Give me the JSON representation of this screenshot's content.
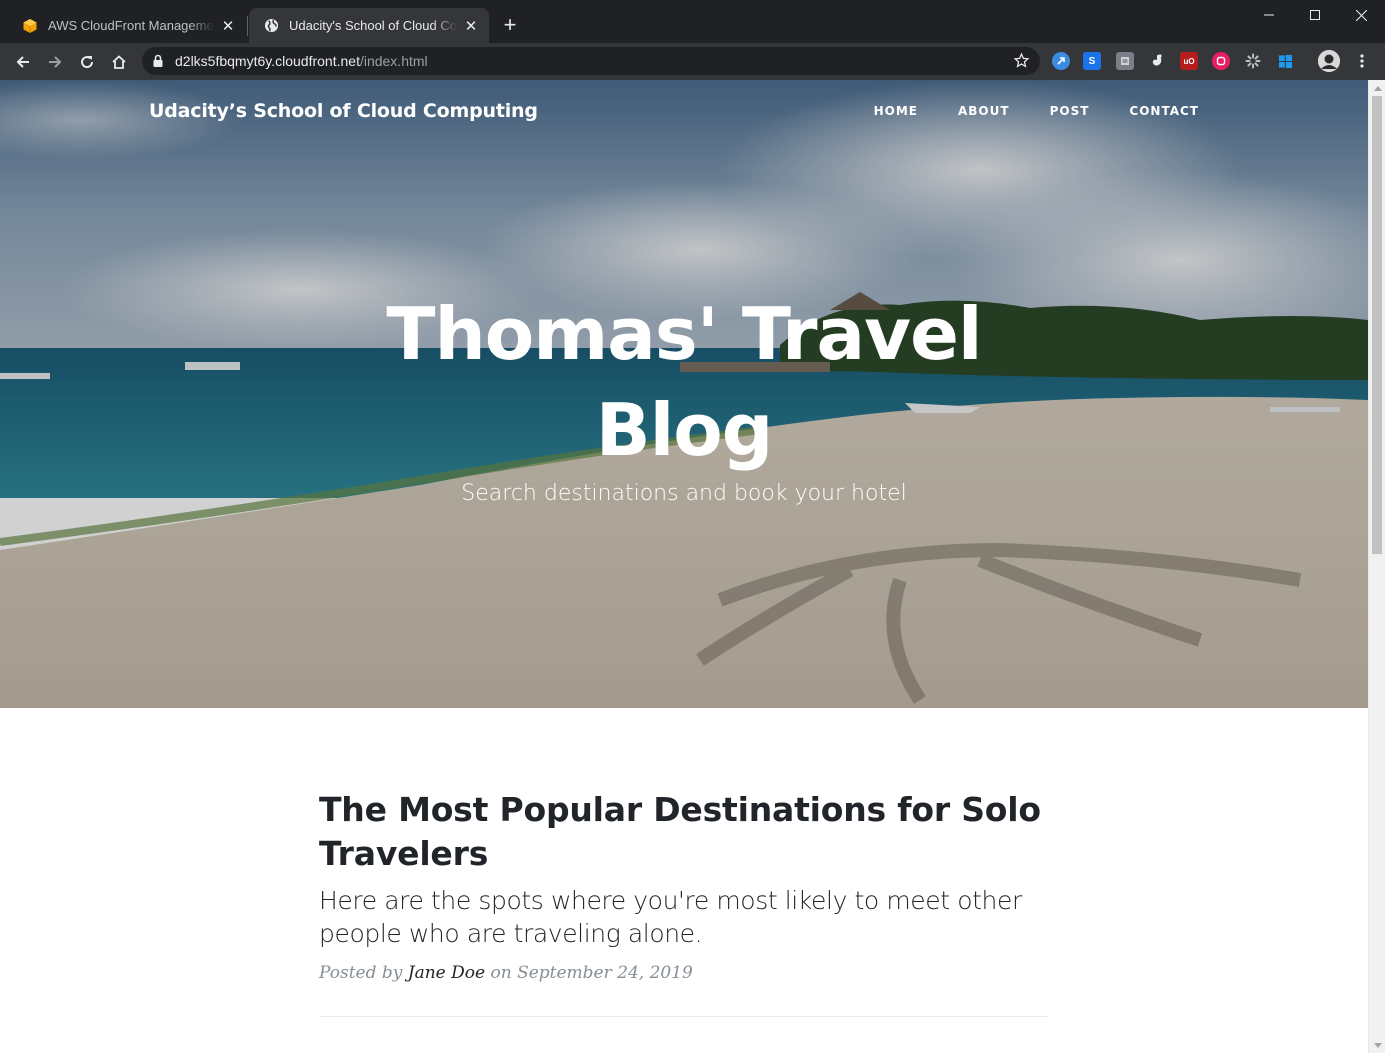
{
  "browser": {
    "tabs": [
      {
        "title": "AWS CloudFront Management Console",
        "favicon": "aws-icon",
        "active": false
      },
      {
        "title": "Udacity's School of Cloud Computing",
        "favicon": "globe-icon",
        "active": true
      }
    ],
    "url_host": "d2lks5fbqmyt6y.cloudfront.net",
    "url_path": "/index.html",
    "extensions": [
      {
        "name": "extension-blue-icon",
        "color": "#3b8be0",
        "glyph": ""
      },
      {
        "name": "extension-s-icon",
        "color": "#1a73e8",
        "glyph": "S"
      },
      {
        "name": "extension-reader-icon",
        "color": "#7a7f87",
        "glyph": ""
      },
      {
        "name": "extension-gear-icon",
        "color": "#35363a",
        "glyph": ""
      },
      {
        "name": "ublock-icon",
        "color": "#b71c1c",
        "glyph": "uO"
      },
      {
        "name": "extension-pink-icon",
        "color": "#e91e63",
        "glyph": ""
      },
      {
        "name": "extension-spinner-icon",
        "color": "#35363a",
        "glyph": ""
      },
      {
        "name": "windows-icon",
        "color": "#35363a",
        "glyph": ""
      }
    ]
  },
  "site": {
    "brand": "Udacity’s School of Cloud Computing",
    "nav": [
      "HOME",
      "ABOUT",
      "POST",
      "CONTACT"
    ],
    "hero_title": "Thomas' Travel Blog",
    "hero_subtitle": "Search destinations and book your hotel"
  },
  "post": {
    "title": "The Most Popular Destinations for Solo Travelers",
    "subtitle": "Here are the spots where you're most likely to meet other people who are traveling alone.",
    "meta_prefix": "Posted by",
    "author": "Jane Doe",
    "meta_on": "on",
    "date": "September 24, 2019"
  }
}
